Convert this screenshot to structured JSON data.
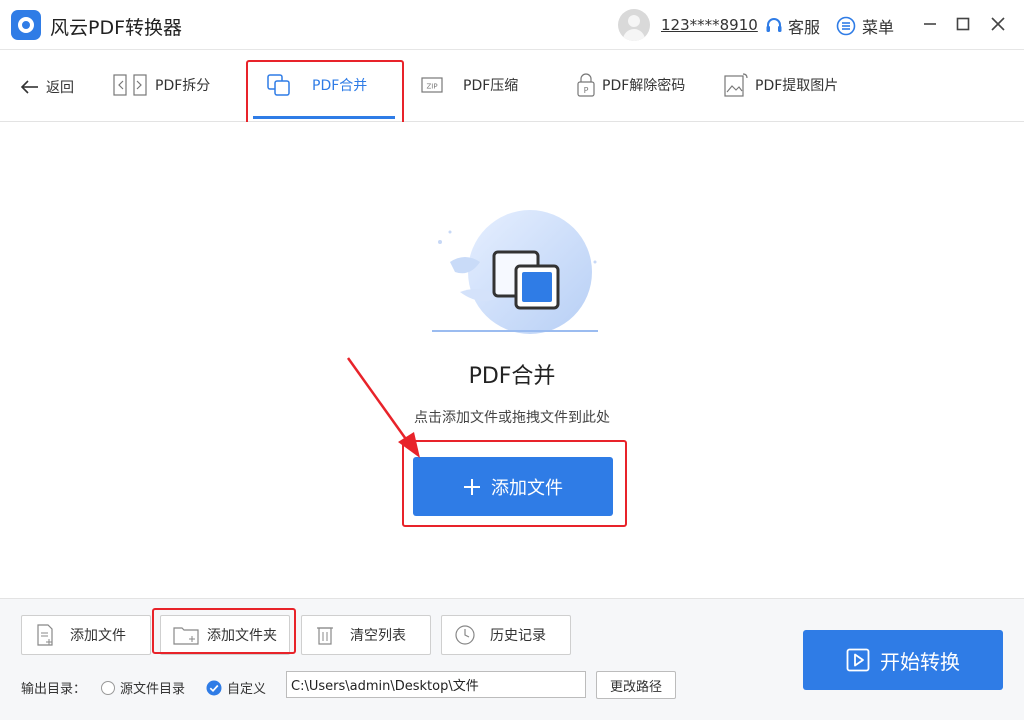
{
  "app": {
    "title": "风云PDF转换器"
  },
  "header": {
    "username": "123****8910",
    "service_label": "客服",
    "menu_label": "菜单",
    "icons": {
      "minimize": "minimize-icon",
      "maximize": "maximize-icon",
      "close": "close-icon"
    }
  },
  "toolbar": {
    "back_label": "返回",
    "tools": [
      {
        "label": "PDF拆分",
        "icon": "split-icon"
      },
      {
        "label": "PDF合并",
        "icon": "merge-icon",
        "active": true
      },
      {
        "label": "PDF压缩",
        "icon": "zip-icon"
      },
      {
        "label": "PDF解除密码",
        "icon": "lock-icon"
      },
      {
        "label": "PDF提取图片",
        "icon": "image-icon"
      }
    ]
  },
  "main": {
    "title": "PDF合并",
    "hint": "点击添加文件或拖拽文件到此处",
    "add_file_label": "添加文件"
  },
  "bottom": {
    "buttons": [
      {
        "label": "添加文件",
        "icon": "add-file-icon"
      },
      {
        "label": "添加文件夹",
        "icon": "add-folder-icon"
      },
      {
        "label": "清空列表",
        "icon": "trash-icon"
      },
      {
        "label": "历史记录",
        "icon": "clock-icon"
      }
    ],
    "output_label": "输出目录：",
    "radio_source": "源文件目录",
    "radio_custom": "自定义",
    "output_path": "C:\\Users\\admin\\Desktop\\文件",
    "change_path_label": "更改路径",
    "start_label": "开始转换"
  },
  "colors": {
    "accent": "#2f7ce6",
    "highlight": "#e8232a"
  }
}
